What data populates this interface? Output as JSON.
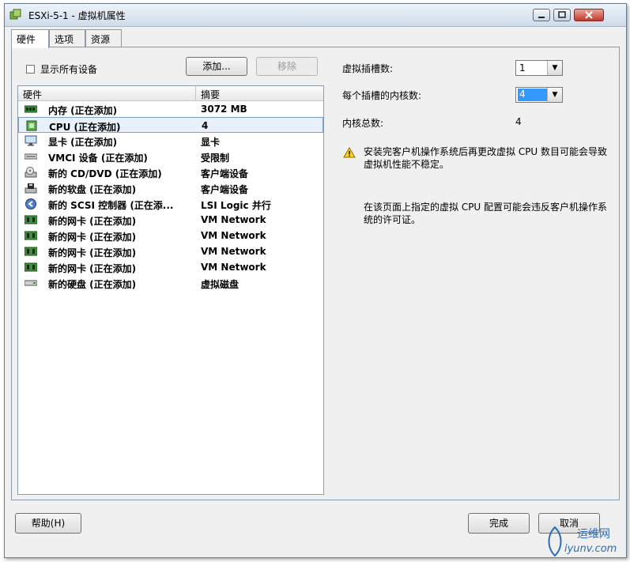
{
  "window": {
    "title": "ESXi-5-1 - 虚拟机属性"
  },
  "tabs": [
    {
      "label": "硬件",
      "active": true
    },
    {
      "label": "选项",
      "active": false
    },
    {
      "label": "资源",
      "active": false
    }
  ],
  "show_all_devices": {
    "label": "显示所有设备",
    "checked": false
  },
  "buttons": {
    "add": "添加...",
    "remove": "移除",
    "help": "帮助(H)",
    "finish": "完成",
    "cancel": "取消"
  },
  "hardware_table": {
    "headers": [
      "硬件",
      "摘要"
    ],
    "rows": [
      {
        "icon": "memory-icon",
        "name": "内存 (正在添加)",
        "summary": "3072 MB"
      },
      {
        "icon": "cpu-icon",
        "name": "CPU (正在添加)",
        "summary": "4",
        "selected": true
      },
      {
        "icon": "display-icon",
        "name": "显卡 (正在添加)",
        "summary": "显卡"
      },
      {
        "icon": "vmci-icon",
        "name": "VMCI 设备 (正在添加)",
        "summary": "受限制"
      },
      {
        "icon": "cd-dvd-icon",
        "name": "新的 CD/DVD (正在添加)",
        "summary": "客户端设备"
      },
      {
        "icon": "floppy-icon",
        "name": "新的软盘 (正在添加)",
        "summary": "客户端设备"
      },
      {
        "icon": "scsi-icon",
        "name": "新的 SCSI 控制器 (正在添...",
        "summary": "LSI Logic 并行"
      },
      {
        "icon": "nic-icon",
        "name": "新的网卡 (正在添加)",
        "summary": "VM Network"
      },
      {
        "icon": "nic-icon",
        "name": "新的网卡 (正在添加)",
        "summary": "VM Network"
      },
      {
        "icon": "nic-icon",
        "name": "新的网卡 (正在添加)",
        "summary": "VM Network"
      },
      {
        "icon": "nic-icon",
        "name": "新的网卡 (正在添加)",
        "summary": "VM Network"
      },
      {
        "icon": "harddisk-icon",
        "name": "新的硬盘 (正在添加)",
        "summary": "虚拟磁盘"
      }
    ]
  },
  "cpu_settings": {
    "sockets_label": "虚拟插槽数:",
    "sockets_value": "1",
    "cores_label": "每个插槽的内核数:",
    "cores_value": "4",
    "total_label": "内核总数:",
    "total_value": "4"
  },
  "messages": {
    "warning": "安装完客户机操作系统后再更改虚拟 CPU 数目可能会导致虚拟机性能不稳定。",
    "license": "在该页面上指定的虚拟 CPU 配置可能会违反客户机操作系统的许可证。"
  },
  "watermark": {
    "cn": "运维网",
    "url": "iyunv.com"
  }
}
